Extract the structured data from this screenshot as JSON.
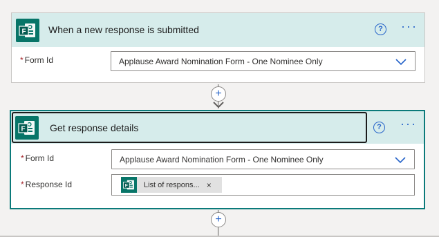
{
  "trigger": {
    "title": "When a new response is submitted",
    "help_icon": "?",
    "more_icon": "···",
    "form_id_label": "Form Id",
    "form_id_value": "Applause Award Nomination Form - One Nominee Only"
  },
  "action": {
    "title": "Get response details",
    "help_icon": "?",
    "more_icon": "···",
    "form_id_label": "Form Id",
    "form_id_value": "Applause Award Nomination Form - One Nominee Only",
    "response_id_label": "Response Id",
    "response_token_label": "List of respons...",
    "response_token_close": "×"
  },
  "connector": {
    "add_symbol": "+"
  },
  "required_marker": "*",
  "colors": {
    "header_bg": "#d6eceb",
    "forms_green": "#077568",
    "accent_blue": "#2563c9",
    "selected_border": "#0b7a7a",
    "required_red": "#a4262c"
  }
}
